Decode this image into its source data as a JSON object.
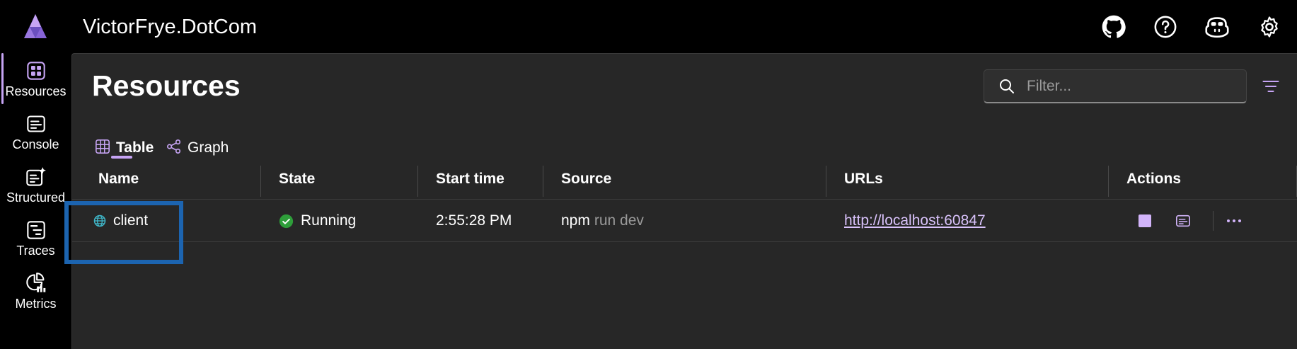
{
  "app": {
    "title": "VictorFrye.DotCom"
  },
  "topbar": {
    "icons": [
      "github-icon",
      "help-icon",
      "copilot-icon",
      "settings-icon"
    ]
  },
  "sidebar": {
    "items": [
      {
        "label": "Resources",
        "icon": "resources-icon",
        "active": true
      },
      {
        "label": "Console",
        "icon": "console-icon",
        "active": false
      },
      {
        "label": "Structured",
        "icon": "structured-icon",
        "active": false
      },
      {
        "label": "Traces",
        "icon": "traces-icon",
        "active": false
      },
      {
        "label": "Metrics",
        "icon": "metrics-icon",
        "active": false
      }
    ]
  },
  "main": {
    "title": "Resources",
    "filter": {
      "placeholder": "Filter...",
      "value": ""
    },
    "tabs": [
      {
        "label": "Table",
        "icon": "table-icon",
        "active": true
      },
      {
        "label": "Graph",
        "icon": "graph-icon",
        "active": false
      }
    ],
    "table": {
      "columns": [
        "Name",
        "State",
        "Start time",
        "Source",
        "URLs",
        "Actions"
      ],
      "rows": [
        {
          "name": "client",
          "state": "Running",
          "start_time": "2:55:28 PM",
          "source_cmd": "npm",
          "source_args": "run dev",
          "url": "http://localhost:60847"
        }
      ]
    }
  },
  "colors": {
    "accent": "#c6a4f4",
    "running": "#2e9e3a",
    "link": "#d9c2fb",
    "highlight": "#1c64b0"
  }
}
